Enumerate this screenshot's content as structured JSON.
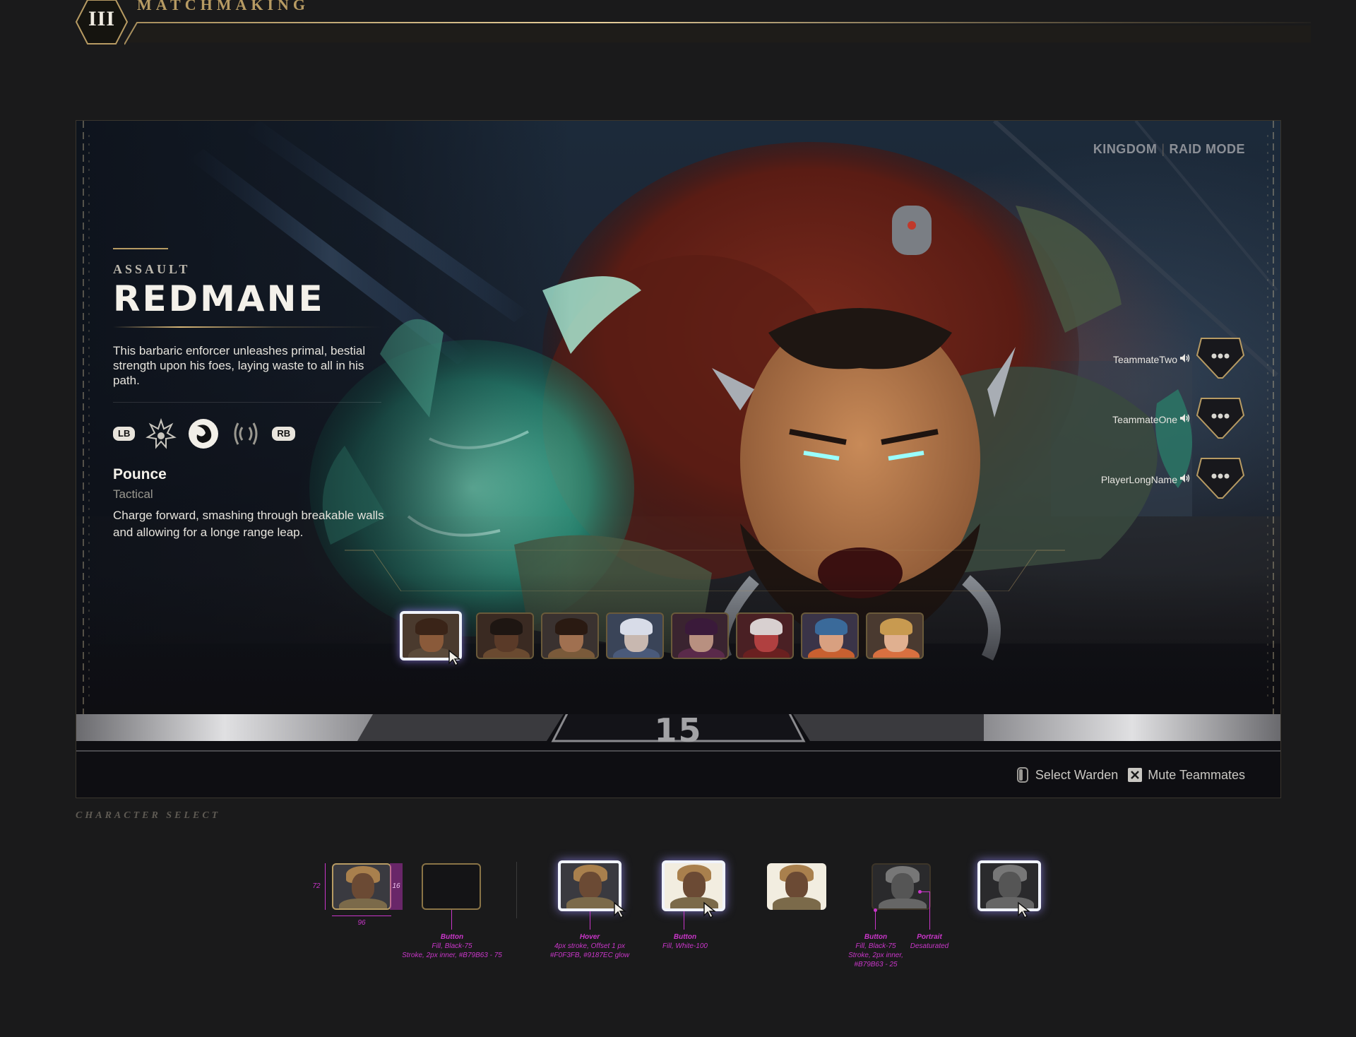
{
  "header": {
    "badge": "III",
    "title": "MATCHMAKING"
  },
  "mode": {
    "left": "KINGDOM",
    "right": "RAID MODE"
  },
  "hero": {
    "class": "ASSAULT",
    "name": "REDMANE",
    "description": "This barbaric enforcer unleashes primal, bestial strength upon his foes, laying waste to all in his path.",
    "lb": "LB",
    "rb": "RB",
    "abilities": [
      "spiked-crest-icon",
      "claw-swirl-icon",
      "roar-icon"
    ],
    "ability": {
      "name": "Pounce",
      "type": "Tactical",
      "description": "Charge forward, smashing through breakable walls and allowing for a longe range leap."
    }
  },
  "team": [
    {
      "name": "TeammateTwo"
    },
    {
      "name": "TeammateOne"
    },
    {
      "name": "PlayerLongName"
    }
  ],
  "roster": [
    {
      "id": "redmane",
      "selected": true,
      "skin": "#8a5a3a",
      "hair": "#3a2418",
      "body": "#5a4a3a",
      "bg": "#4a3a2e"
    },
    {
      "id": "warden-2",
      "selected": false,
      "skin": "#5a3a28",
      "hair": "#1e1612",
      "body": "#6a4a30",
      "bg": "#3a2a22"
    },
    {
      "id": "warden-3",
      "selected": false,
      "skin": "#a07050",
      "hair": "#2a1a12",
      "body": "#7a5a3a",
      "bg": "#3a3230"
    },
    {
      "id": "warden-4",
      "selected": false,
      "skin": "#c8b8b0",
      "hair": "#d8dce8",
      "body": "#4a5a7a",
      "bg": "#3a4458"
    },
    {
      "id": "warden-5",
      "selected": false,
      "skin": "#b89080",
      "hair": "#3a1a3a",
      "body": "#5a2a4a",
      "bg": "#3a2430"
    },
    {
      "id": "warden-6",
      "selected": false,
      "skin": "#b04040",
      "hair": "#d8d0d0",
      "body": "#6a2020",
      "bg": "#4a2024"
    },
    {
      "id": "warden-7",
      "selected": false,
      "skin": "#d8a080",
      "hair": "#3a6a9a",
      "body": "#c86030",
      "bg": "#3a3448"
    },
    {
      "id": "warden-8",
      "selected": false,
      "skin": "#e0b090",
      "hair": "#c89a50",
      "body": "#d87040",
      "bg": "#4a3a30"
    }
  ],
  "timer": "15",
  "prompts": [
    {
      "icon": "controller-trigger-icon",
      "label": "Select Warden"
    },
    {
      "icon": "x-button-icon",
      "label": "Mute Teammates"
    }
  ],
  "section_label": "CHARACTER SELECT",
  "spec": {
    "dim_height": "72",
    "dim_width": "96",
    "dim_inner": "16",
    "notes": [
      {
        "title": "Button",
        "lines": [
          "Fill, Black-75",
          "Stroke, 2px inner, #B79B63 - 75"
        ]
      },
      {
        "title": "Hover",
        "lines": [
          "4px stroke, Offset 1 px",
          "#F0F3FB, #9187EC glow"
        ]
      },
      {
        "title": "Button",
        "lines": [
          "Fill, White-100"
        ]
      },
      {
        "title": "Button",
        "lines": [
          "Fill, Black-75",
          "Stroke, 2px inner,",
          "#B79B63 - 25"
        ]
      },
      {
        "title": "Portrait",
        "lines": [
          "Desaturated"
        ]
      }
    ]
  },
  "colors": {
    "accent_gold": "#B79B63",
    "hover_stroke": "#F0F3FB",
    "hover_glow": "#9187EC",
    "spec_magenta": "#C936C9"
  }
}
